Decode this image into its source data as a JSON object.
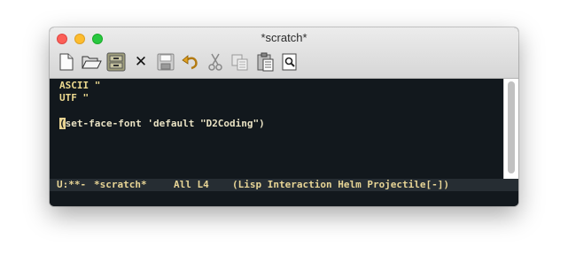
{
  "window": {
    "title": "*scratch*"
  },
  "toolbar": {
    "buttons": [
      {
        "icon": "new-file-icon"
      },
      {
        "icon": "open-folder-icon"
      },
      {
        "icon": "dired-cabinet-icon"
      },
      {
        "icon": "close-x-icon",
        "label": "✕"
      },
      {
        "icon": "save-disk-icon"
      },
      {
        "icon": "undo-icon"
      },
      {
        "icon": "cut-scissors-icon"
      },
      {
        "icon": "copy-icon"
      },
      {
        "icon": "paste-clipboard-icon"
      },
      {
        "icon": "search-icon"
      }
    ]
  },
  "buffer": {
    "lines": [
      "ASCII \"",
      "UTF \"",
      "",
      "set-face-font 'default \"D2Coding\")"
    ],
    "cursor_char": "("
  },
  "modeline": {
    "status": "U:**-",
    "buffer_name": "*scratch*",
    "position": "All L4",
    "modes": "(Lisp Interaction Helm Projectile[-])"
  },
  "colors": {
    "background": "#12181d",
    "text": "#e8e1c3",
    "modeline_bg": "#262d33",
    "modeline_text": "#e8d596",
    "cursor": "#e8d392"
  }
}
